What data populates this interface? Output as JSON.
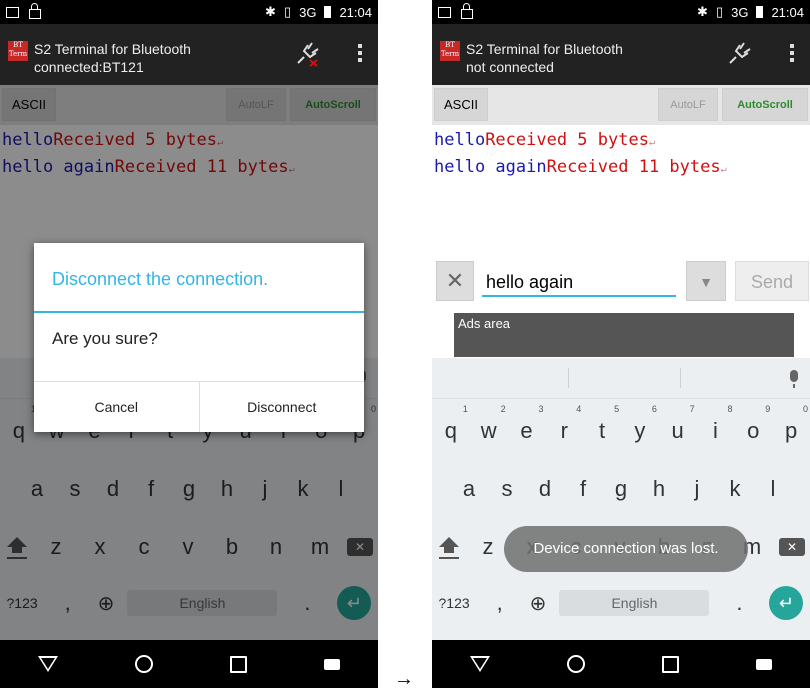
{
  "left": {
    "status": {
      "time": "21:04",
      "network": "3G"
    },
    "appbar": {
      "logo_text": "BT\nTerm",
      "title": "S2 Terminal for Bluetooth",
      "subtitle": "connected:BT121"
    },
    "toolbar": {
      "ascii": "ASCII",
      "autolf": "AutoLF",
      "autoscroll": "AutoScroll"
    },
    "terminal": [
      {
        "sent": "hello",
        "recv": "Received 5 bytes"
      },
      {
        "sent": "hello again",
        "recv": "Received 11 bytes"
      }
    ],
    "dialog": {
      "title": "Disconnect the connection.",
      "message": "Are you sure?",
      "cancel": "Cancel",
      "confirm": "Disconnect"
    },
    "keyboard": {
      "space": "English",
      "sym": "?123"
    }
  },
  "right": {
    "status": {
      "time": "21:04",
      "network": "3G"
    },
    "appbar": {
      "logo_text": "BT\nTerm",
      "title": "S2 Terminal for Bluetooth",
      "subtitle": "not connected"
    },
    "toolbar": {
      "ascii": "ASCII",
      "autolf": "AutoLF",
      "autoscroll": "AutoScroll"
    },
    "terminal": [
      {
        "sent": "hello",
        "recv": "Received 5 bytes"
      },
      {
        "sent": "hello again",
        "recv": "Received 11 bytes"
      }
    ],
    "input": {
      "value": "hello again",
      "send": "Send"
    },
    "ads": "Ads area",
    "toast": "Device connection was lost.",
    "keyboard": {
      "space": "English",
      "sym": "?123"
    }
  },
  "keyboard_rows": {
    "row1": [
      "q",
      "w",
      "e",
      "r",
      "t",
      "y",
      "u",
      "i",
      "o",
      "p"
    ],
    "row1_hints": [
      "1",
      "2",
      "3",
      "4",
      "5",
      "6",
      "7",
      "8",
      "9",
      "0"
    ],
    "row2": [
      "a",
      "s",
      "d",
      "f",
      "g",
      "h",
      "j",
      "k",
      "l"
    ],
    "row3": [
      "z",
      "x",
      "c",
      "v",
      "b",
      "n",
      "m"
    ]
  },
  "arrow": "→",
  "colors": {
    "accent": "#33b5e5",
    "sent": "#1a1ab0",
    "received": "#d01010",
    "autoscroll": "#2e8b2e"
  }
}
